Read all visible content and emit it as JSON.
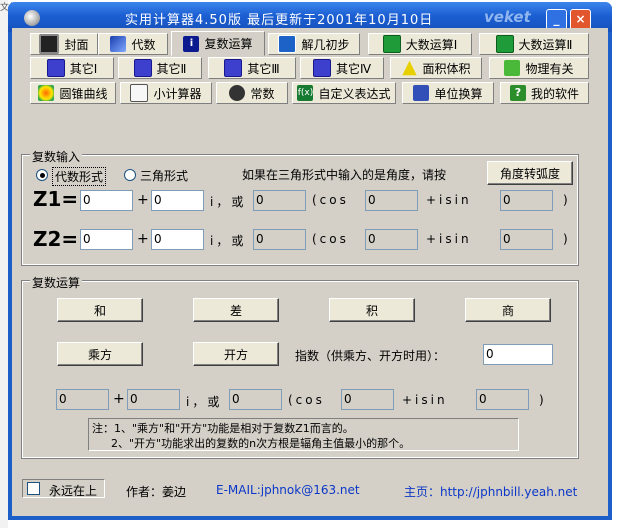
{
  "window": {
    "edge_text": "文件(",
    "title": "实用计算器4.50版  最后更新于2001年10月10日",
    "brand": "veket",
    "minimize": "_",
    "close": "×"
  },
  "tabs": [
    {
      "label": "封面",
      "icon": "hat-icon"
    },
    {
      "label": "代数",
      "icon": "algebra-icon"
    },
    {
      "label": "复数运算",
      "icon": "complex-icon",
      "active": true
    },
    {
      "label": "解几初步",
      "icon": "analytic-geometry-icon"
    },
    {
      "label": "大数运算Ⅰ",
      "icon": "big-number-icon"
    },
    {
      "label": "大数运算Ⅱ",
      "icon": "big-number-icon"
    },
    {
      "label": "其它Ⅰ",
      "icon": "other-icon"
    },
    {
      "label": "其它Ⅱ",
      "icon": "other-icon"
    },
    {
      "label": "其它Ⅲ",
      "icon": "other-icon"
    },
    {
      "label": "其它Ⅳ",
      "icon": "other-icon"
    },
    {
      "label": "面积体积",
      "icon": "triangle-icon"
    },
    {
      "label": "物理有关",
      "icon": "physics-icon"
    },
    {
      "label": "圆锥曲线",
      "icon": "conic-icon"
    },
    {
      "label": "小计算器",
      "icon": "calculator-icon"
    },
    {
      "label": "常数",
      "icon": "constant-icon"
    },
    {
      "label": "自定义表达式",
      "icon": "fx-icon"
    },
    {
      "label": "单位换算",
      "icon": "unit-convert-icon"
    },
    {
      "label": "我的软件",
      "icon": "my-software-icon"
    }
  ],
  "complex_input": {
    "legend": "复数输入",
    "radio_algebraic": "代数形式",
    "radio_trig": "三角形式",
    "selected_form": "代数形式",
    "hint": "如果在三角形式中输入的是角度，请按",
    "deg_to_rad_button": "角度转弧度",
    "z1_label": "Z1=",
    "z2_label": "Z2=",
    "plus": "+",
    "i_or": "i，或",
    "cos": "(cos",
    "isin": "+isin",
    "close_paren": ")",
    "z1": {
      "real": "0",
      "imag": "0",
      "modulus": "0",
      "cos_angle": "0",
      "sin_angle": "0"
    },
    "z2": {
      "real": "0",
      "imag": "0",
      "modulus": "0",
      "cos_angle": "0",
      "sin_angle": "0"
    }
  },
  "complex_ops": {
    "legend": "复数运算",
    "sum": "和",
    "difference": "差",
    "product": "积",
    "quotient": "商",
    "power": "乘方",
    "root": "开方",
    "exponent_label": "指数（供乘方、开方时用）：",
    "exponent_value": "0",
    "result": {
      "real": "0",
      "imag": "0",
      "modulus": "0",
      "cos_angle": "0",
      "sin_angle": "0"
    },
    "note_line1": "注：1、\"乘方\"和\"开方\"功能是相对于复数Z1而言的。",
    "note_line2": "2、\"开方\"功能求出的复数的n次方根是辐角主值最小的那个。"
  },
  "footer": {
    "always_on_top": "永远在上",
    "always_on_top_checked": false,
    "author": "作者：姜边",
    "email": "E-MAIL:jphnok@163.net",
    "homepage": "主页：http://jphnbill.yeah.net"
  }
}
